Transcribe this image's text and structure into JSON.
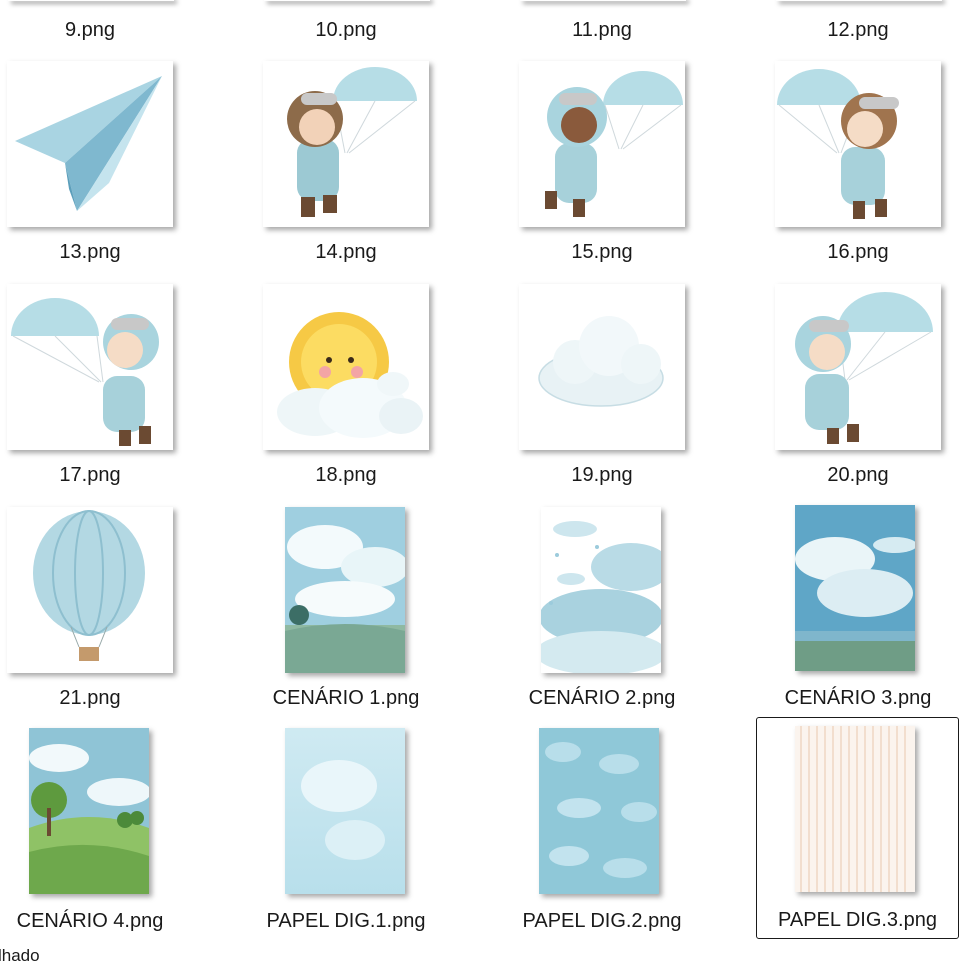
{
  "files": [
    {
      "name": "9.png",
      "icon": "top-cropped-thumbnail"
    },
    {
      "name": "10.png",
      "icon": "top-cropped-thumbnail"
    },
    {
      "name": "11.png",
      "icon": "top-cropped-thumbnail"
    },
    {
      "name": "12.png",
      "icon": "top-cropped-thumbnail"
    },
    {
      "name": "13.png",
      "icon": "paper-airplane-image"
    },
    {
      "name": "14.png",
      "icon": "aviator-boy-parachute-image"
    },
    {
      "name": "15.png",
      "icon": "aviator-girl-parachute-image"
    },
    {
      "name": "16.png",
      "icon": "aviator-blond-boy-parachute-image"
    },
    {
      "name": "17.png",
      "icon": "aviator-redhead-boy-parachute-image"
    },
    {
      "name": "18.png",
      "icon": "sun-on-cloud-image"
    },
    {
      "name": "19.png",
      "icon": "cloud-image"
    },
    {
      "name": "20.png",
      "icon": "aviator-boy-parachute-image"
    },
    {
      "name": "21.png",
      "icon": "hot-air-balloon-image"
    },
    {
      "name": "CENÁRIO 1.png",
      "icon": "sky-landscape-image"
    },
    {
      "name": "CENÁRIO 2.png",
      "icon": "cloudscape-image"
    },
    {
      "name": "CENÁRIO 3.png",
      "icon": "sky-sea-landscape-image"
    },
    {
      "name": "CENÁRIO 4.png",
      "icon": "green-hills-landscape-image"
    },
    {
      "name": "PAPEL DIG.1.png",
      "icon": "light-blue-paper-image"
    },
    {
      "name": "PAPEL DIG.2.png",
      "icon": "blue-cloud-paper-image"
    },
    {
      "name": "PAPEL DIG.3.png",
      "icon": "striped-paper-image"
    }
  ],
  "selected_file": "PAPEL DIG.3.png",
  "status_bar": {
    "text": "lhado"
  },
  "colors": {
    "selection_border": "#1a1a1a",
    "sky_blue": "#bfe0ea",
    "deep_blue": "#5ba3c2"
  }
}
